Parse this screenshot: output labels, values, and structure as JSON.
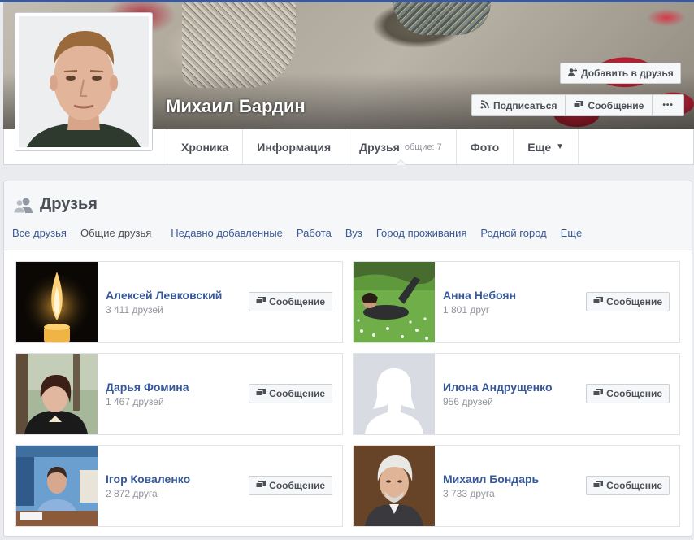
{
  "profile": {
    "name": "Михаил Бардин",
    "add_friend_label": "Добавить в друзья",
    "subscribe_label": "Подписаться",
    "message_label": "Сообщение",
    "more_label": "•••"
  },
  "tabs": [
    {
      "label": "Хроника"
    },
    {
      "label": "Информация"
    },
    {
      "label": "Друзья",
      "count": "общие: 7"
    },
    {
      "label": "Фото"
    },
    {
      "label": "Еще",
      "caret": "▼"
    }
  ],
  "friends_section": {
    "title": "Друзья",
    "filters": [
      "Все друзья",
      "Общие друзья",
      "Недавно добавленные",
      "Работа",
      "Вуз",
      "Город проживания",
      "Родной город",
      "Еще"
    ],
    "selected_filter": "Общие друзья",
    "message_label": "Сообщение",
    "items": [
      {
        "name": "Алексей Левковский",
        "count": "3 411 друзей",
        "photo": "candle"
      },
      {
        "name": "Анна Небоян",
        "count": "1 801 друг",
        "photo": "grass"
      },
      {
        "name": "Дарья Фомина",
        "count": "1 467 друзей",
        "photo": "woman-park"
      },
      {
        "name": "Илона Андрущенко",
        "count": "956 друзей",
        "photo": "silhouette"
      },
      {
        "name": "Ігор Коваленко",
        "count": "2 872 друга",
        "photo": "office"
      },
      {
        "name": "Михаил Бондарь",
        "count": "3 733 друга",
        "photo": "older-man"
      }
    ]
  },
  "colors": {
    "link": "#365899",
    "brand": "#3b5998",
    "button_bg": "#f6f7f9"
  }
}
